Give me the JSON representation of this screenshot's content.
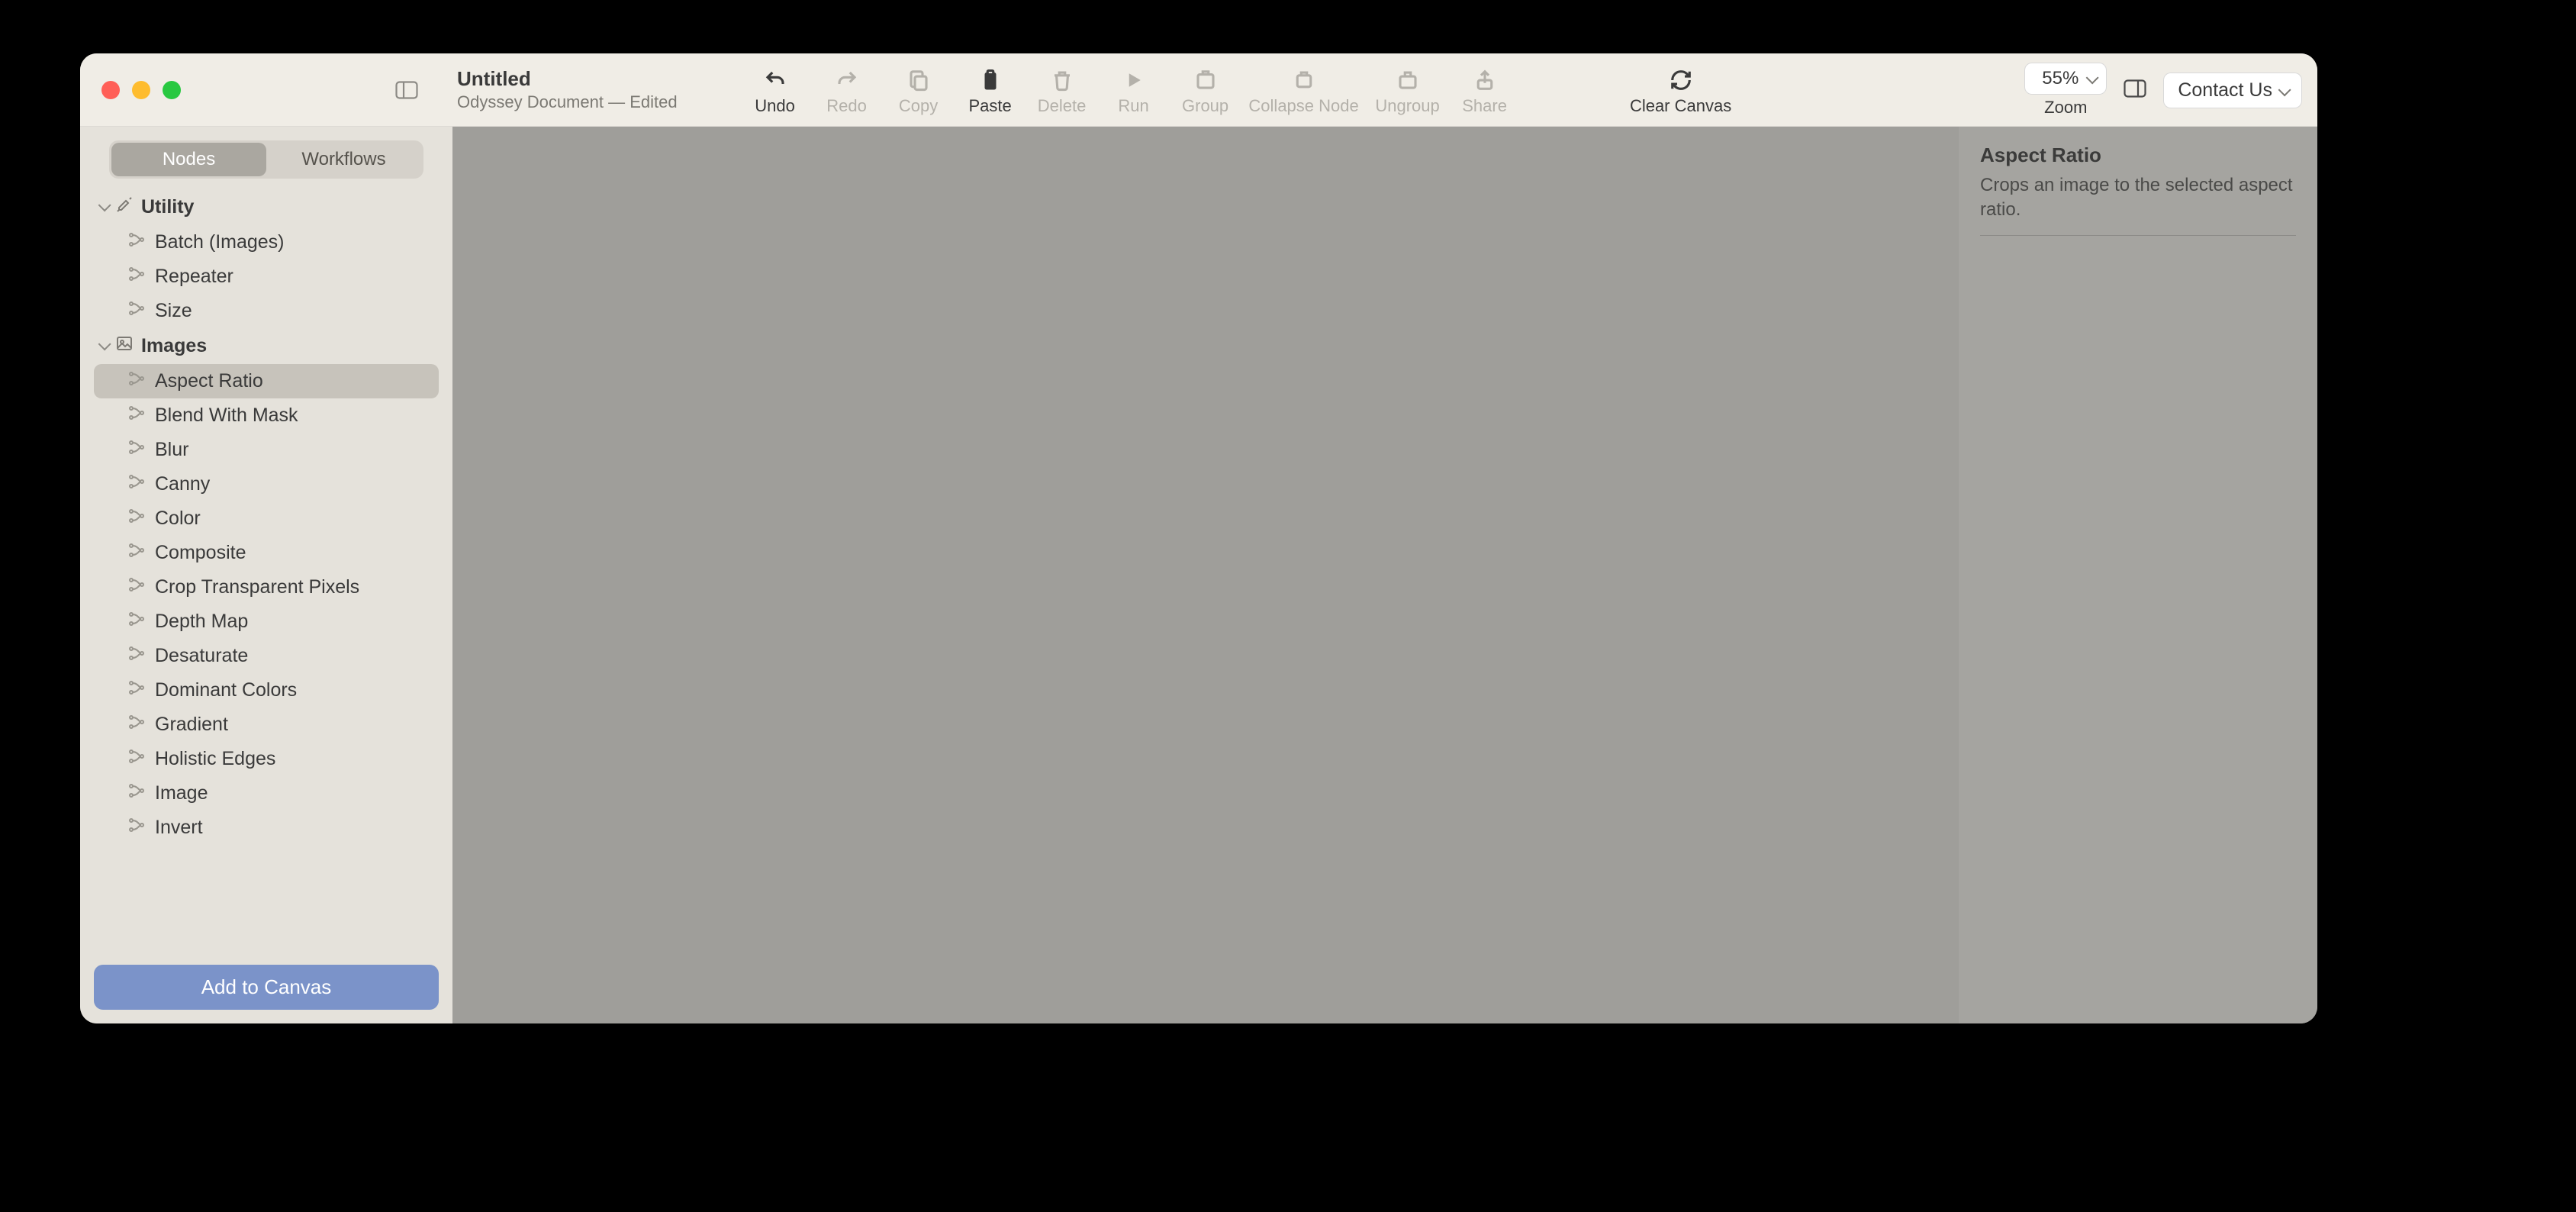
{
  "document": {
    "title": "Untitled",
    "subtitle": "Odyssey Document — Edited"
  },
  "toolbar": {
    "undo": "Undo",
    "redo": "Redo",
    "copy": "Copy",
    "paste": "Paste",
    "delete": "Delete",
    "run": "Run",
    "group": "Group",
    "collapse_node": "Collapse Node",
    "ungroup": "Ungroup",
    "share": "Share",
    "clear_canvas": "Clear Canvas",
    "zoom": "Zoom",
    "zoom_value": "55%",
    "contact_us": "Contact Us"
  },
  "segmented": {
    "nodes": "Nodes",
    "workflows": "Workflows"
  },
  "sidebar": {
    "groups": [
      {
        "label": "Utility",
        "items": [
          "Batch (Images)",
          "Repeater",
          "Size"
        ]
      },
      {
        "label": "Images",
        "items": [
          "Aspect Ratio",
          "Blend With Mask",
          "Blur",
          "Canny",
          "Color",
          "Composite",
          "Crop Transparent Pixels",
          "Depth Map",
          "Desaturate",
          "Dominant Colors",
          "Gradient",
          "Holistic Edges",
          "Image",
          "Invert"
        ]
      }
    ],
    "selected_item": "Aspect Ratio",
    "add_to_canvas": "Add to Canvas"
  },
  "inspector": {
    "title": "Aspect Ratio",
    "description": "Crops an image to the selected aspect ratio."
  }
}
